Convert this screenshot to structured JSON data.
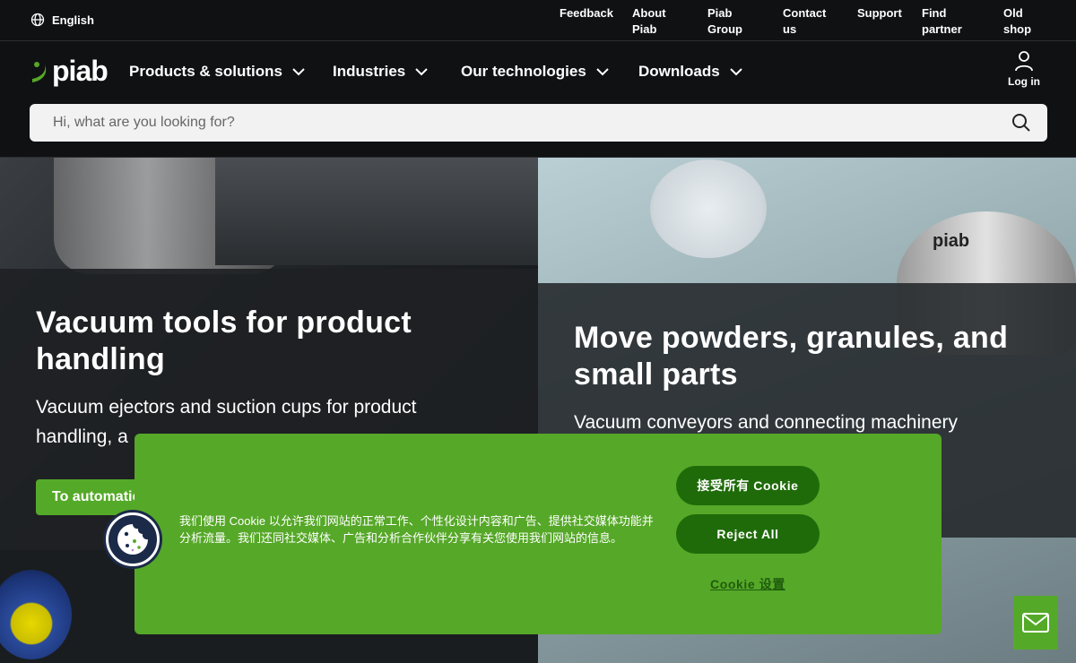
{
  "topbar": {
    "language": "English",
    "links": [
      {
        "label": "Feedback"
      },
      {
        "label": "About\nPiab"
      },
      {
        "label": "Piab\nGroup"
      },
      {
        "label": "Contact\nus"
      },
      {
        "label": "Support"
      },
      {
        "label": "Find\npartner"
      },
      {
        "label": "Old\nshop"
      }
    ]
  },
  "nav": {
    "logo_text": "piab",
    "menu": [
      {
        "label": "Products & solutions"
      },
      {
        "label": "Industries"
      },
      {
        "label": "Our technologies"
      },
      {
        "label": "Downloads"
      }
    ],
    "login_label": "Log in"
  },
  "search": {
    "placeholder": "Hi, what are you looking for?",
    "value": ""
  },
  "hero": {
    "left": {
      "title": "Vacuum tools for product\nhandling",
      "subtitle": "Vacuum ejectors and suction cups for product\nhandling, a",
      "cta_label": "To automatio"
    },
    "right": {
      "title": "Move powders, granules, and\nsmall parts",
      "subtitle": "Vacuum conveyors and connecting machinery",
      "brand_mark": "piab"
    }
  },
  "cookie": {
    "text": "我们使用 Cookie 以允许我们网站的正常工作、个性化设计内容和广告、提供社交媒体功能并分析流量。我们还同社交媒体、广告和分析合作伙伴分享有关您使用我们网站的信息。",
    "accept_label": "接受所有 Cookie",
    "reject_label": "Reject All",
    "settings_label": "Cookie 设置"
  },
  "colors": {
    "brand_green": "#56a828",
    "dark_green": "#1f6b0a",
    "background": "#0f1112"
  },
  "icons": {
    "language": "globe-icon",
    "menu_chevron": "chevron-down-icon",
    "login": "user-icon",
    "search": "search-icon",
    "cookie": "cookie-icon",
    "contact": "mail-icon"
  }
}
